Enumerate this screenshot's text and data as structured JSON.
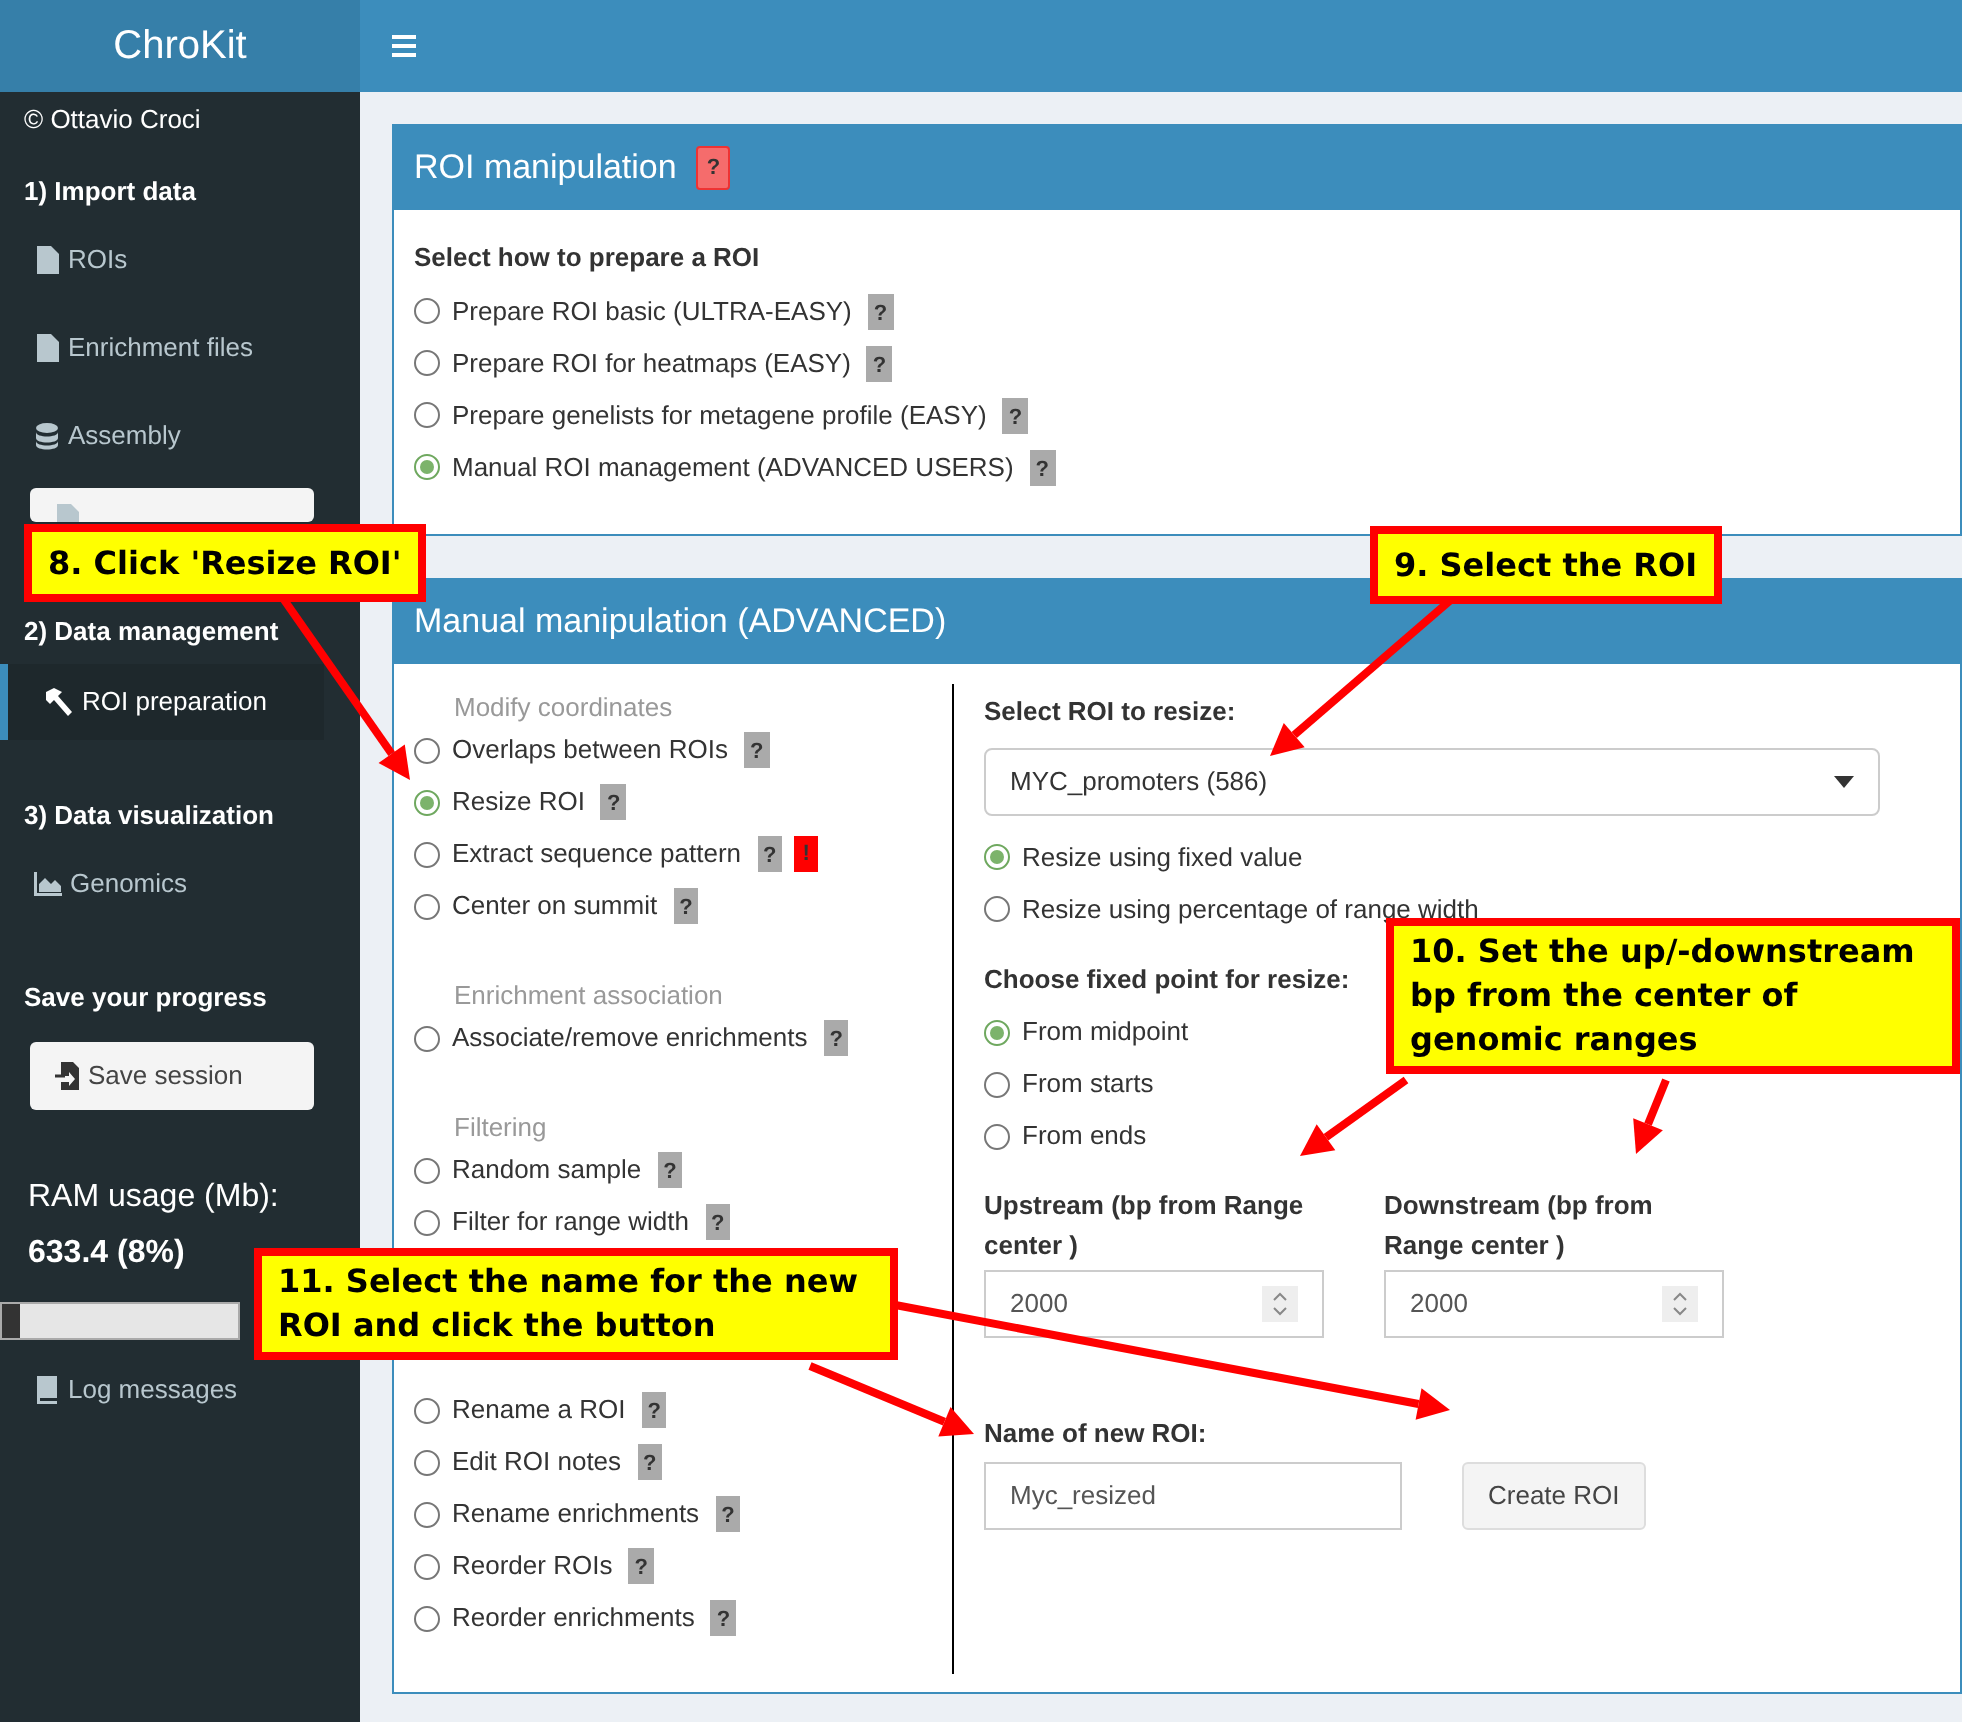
{
  "app": {
    "title": "ChroKit"
  },
  "sidebar": [
    {
      "kind": "note",
      "text": "© Ottavio Croci"
    },
    {
      "kind": "heading",
      "text": "1) Import data"
    },
    {
      "kind": "item",
      "label": "ROIs",
      "selected": false
    },
    {
      "kind": "item",
      "label": "Enrichment files",
      "selected": false
    },
    {
      "kind": "item",
      "label": "Assembly",
      "selected": false
    },
    {
      "kind": "button"
    },
    {
      "kind": "heading",
      "text": "2) Data management"
    },
    {
      "kind": "item",
      "label": "ROI preparation",
      "selected": true
    },
    {
      "kind": "heading",
      "text": "3) Data visualization"
    },
    {
      "kind": "item",
      "label": "Genomics",
      "selected": false
    },
    {
      "kind": "heading",
      "text": "Save your progress"
    },
    {
      "kind": "button",
      "label": "Save session"
    },
    {
      "kind": "ram",
      "label": "RAM usage (Mb):",
      "value": "633.4 (8%)"
    },
    {
      "kind": "meter",
      "level": 0.08
    },
    {
      "kind": "item",
      "label": "Log messages",
      "selected": false
    }
  ],
  "roi_box": {
    "title": "ROI manipulation",
    "badge": "?",
    "label": "Select how to prepare a ROI",
    "options": [
      {
        "label": "Prepare ROI basic (ULTRA-EASY)",
        "selected": false,
        "help": "?"
      },
      {
        "label": "Prepare ROI for heatmaps (EASY)",
        "selected": false,
        "help": "?"
      },
      {
        "label": "Prepare genelists for metagene profile (EASY)",
        "selected": false,
        "help": "?"
      },
      {
        "label": "Manual ROI management (ADVANCED USERS)",
        "selected": true,
        "help": "?"
      }
    ]
  },
  "manual_box": {
    "title": "Manual manipulation (ADVANCED)",
    "groups": [
      {
        "title": "Modify coordinates",
        "options": [
          {
            "label": "Overlaps between ROIs",
            "selected": false,
            "help": "?"
          },
          {
            "label": "Resize ROI",
            "selected": true,
            "help": "?"
          },
          {
            "label": "Extract sequence pattern",
            "selected": false,
            "help": "?",
            "warning": "!"
          },
          {
            "label": "Center on summit",
            "selected": false,
            "help": "?"
          }
        ]
      },
      {
        "title": "Enrichment association",
        "options": [
          {
            "label": "Associate/remove enrichments",
            "selected": false,
            "help": "?"
          }
        ]
      },
      {
        "title": "Filtering",
        "options": [
          {
            "label": "Random sample",
            "selected": false,
            "help": "?"
          },
          {
            "label": "Filter for range width",
            "selected": false,
            "help": "?"
          }
        ]
      },
      {
        "options": [
          {
            "label": "Rename a ROI",
            "selected": false,
            "help": "?"
          },
          {
            "label": "Edit ROI notes",
            "selected": false,
            "help": "?"
          },
          {
            "label": "Rename enrichments",
            "selected": false,
            "help": "?"
          },
          {
            "label": "Reorder ROIs",
            "selected": false,
            "help": "?"
          },
          {
            "label": "Reorder enrichments",
            "selected": false,
            "help": "?"
          }
        ]
      }
    ],
    "select": {
      "label": "Select ROI to resize:",
      "value": "MYC_promoters (586)"
    },
    "resize_mode": [
      {
        "label": "Resize using fixed value",
        "selected": true
      },
      {
        "label": "Resize using percentage of range width",
        "selected": false
      }
    ],
    "fixed_point": {
      "label": "Choose fixed point for resize:",
      "options": [
        {
          "label": "From midpoint",
          "selected": true
        },
        {
          "label": "From starts",
          "selected": false
        },
        {
          "label": "From ends",
          "selected": false
        }
      ]
    },
    "upstream": {
      "label": "Upstream (bp from Range center )",
      "value": "2000"
    },
    "downstream": {
      "label": "Downstream (bp from Range center )",
      "value": "2000"
    },
    "name_field": {
      "label": "Name of new ROI:",
      "value": "Myc_resized"
    },
    "button": "Create ROI"
  },
  "annotations": [
    {
      "text": "8. Click 'Resize ROI'"
    },
    {
      "text": "9. Select the ROI"
    },
    {
      "text": "10. Set the up/-downstream bp from the center of genomic ranges"
    },
    {
      "text": "11. Select the name for the new ROI and click the button"
    }
  ]
}
